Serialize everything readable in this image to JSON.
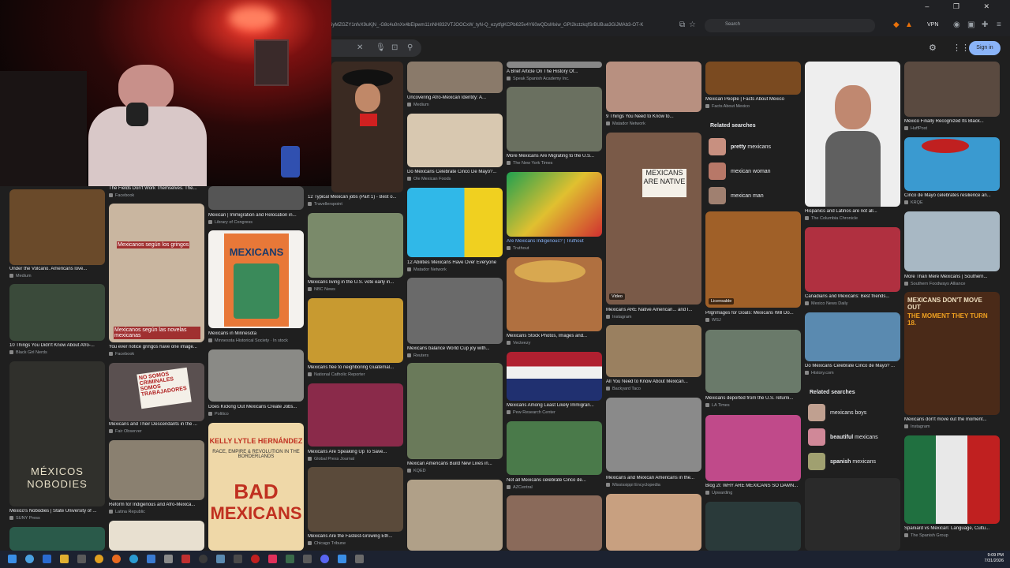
{
  "browser": {
    "url": "iyMZGZY1nfvX9uKjN_-G8c4u0nXx4bElpwm11nNH832VTJOOCxW_tyN-Q_ezytfgKCPb625v4Y60wQDsMxiw_GPI2kctzkqfSrBUBua3GiJMAb3-OT-K",
    "search_placeholder": "Search",
    "vpn_label": "VPN",
    "window_controls": "– ❐ ✕"
  },
  "google": {
    "sign_in": "Sign in"
  },
  "columns": [
    {
      "items": [
        {
          "caption": "The Fields Don't Work Themselves. The...",
          "source": "Facebook"
        },
        {
          "caption": "Under the Volcano. Americans love...",
          "source": "Medium"
        },
        {
          "caption": "10 Things You Didn't Know About Afro-...",
          "source": "Black Girl Nerds"
        },
        {
          "caption": "México's Nobodies | State University of ...",
          "source": "SUNY Press"
        }
      ]
    },
    {
      "items": [
        {
          "caption": "You ever notice gringos have one image...",
          "source": "Facebook"
        },
        {
          "caption": "Mexicans and Their Descendants in the ...",
          "source": "Fair Observer"
        },
        {
          "caption": "Reform for Indigenous and Afro-Mexica...",
          "source": "Latina Republic"
        }
      ]
    },
    {
      "items": [
        {
          "caption": "Mexican | Immigration and Relocation in...",
          "source": "Library of Congress"
        },
        {
          "caption": "Mexicans in Minnesota",
          "source": "Minnesota Historical Society · In stock"
        },
        {
          "caption": "Does Kicking Out Mexicans Create Jobs...",
          "source": "Politico"
        }
      ]
    },
    {
      "items": [
        {
          "caption": "12 Typical Mexican jobs (Part 1) - Best o...",
          "source": "Travellerspoint"
        },
        {
          "caption": "Mexicans living in the U.S. vote early in...",
          "source": "NBC News"
        },
        {
          "caption": "Mexicans flee to neighboring Guatemal...",
          "source": "National Catholic Reporter"
        },
        {
          "caption": "Mexicans Are Speaking Up To Save...",
          "source": "Global Press Journal"
        },
        {
          "caption": "Mexicans Are the Fastest-Growing Eth...",
          "source": "Chicago Tribune"
        }
      ]
    },
    {
      "items": [
        {
          "caption": "Uncovering Afro-Mexican Identity: A...",
          "source": "Medium"
        },
        {
          "caption": "Do Mexicans Celebrate Cinco De Mayo?...",
          "source": "Ole Mexican Foods"
        },
        {
          "caption": "12 Abilities Mexicans Have Over Everyone",
          "source": "Matador Network"
        },
        {
          "caption": "Mexicans balance World Cup joy with...",
          "source": "Reuters"
        },
        {
          "caption": "Mexican Americans Build New Lives in...",
          "source": "KQED"
        }
      ]
    },
    {
      "items": [
        {
          "caption": "A Brief Article On The History Of...",
          "source": "Speak Spanish Academy Inc."
        },
        {
          "caption": "More Mexicans Are Migrating to the U.S...",
          "source": "The New York Times"
        },
        {
          "caption": "Are Mexicans Indigenous? | Truthout",
          "source": "Truthout"
        },
        {
          "caption": "Mexicans Stock Photos, Images and...",
          "source": "Vecteezy"
        },
        {
          "caption": "Mexicans Among Least Likely Immigran...",
          "source": "Pew Research Center"
        },
        {
          "caption": "Not all Mexicans celebrate Cinco de...",
          "source": "AZCentral"
        }
      ]
    },
    {
      "items": [
        {
          "caption": "9 Things You Need to Know to...",
          "source": "Matador Network"
        },
        {
          "caption": "MEXICANS ARE NATIVE",
          "source": ""
        },
        {
          "caption": "Mexicans ARE Native American... and I...",
          "source": "Instagram"
        },
        {
          "caption": "All You Need to Know About Mexican...",
          "source": "Backyard Taco"
        },
        {
          "caption": "Mexicans and Mexican Americans in the...",
          "source": "Mississippi Encyclopedia"
        }
      ]
    },
    {
      "items": [
        {
          "caption": "Mexican People | Facts About Mexico",
          "source": "Facts About Mexico"
        },
        {
          "caption": "Pilgrimages for Goals: Mexicans Will Do...",
          "source": "WSJ"
        },
        {
          "caption": "Mexicans deported from the U.S. returni...",
          "source": "LA Times"
        },
        {
          "caption": "Blog 2I: WHY ARE MEXICANS SO DAMN...",
          "source": "Upwarding"
        }
      ]
    },
    {
      "items": [
        {
          "caption": "Hispanics and Latinos are not all...",
          "source": "The Columbia Chronicle"
        },
        {
          "caption": "Canadians and Mexicans: Best friends...",
          "source": "Mexico News Daily"
        },
        {
          "caption": "Do Mexicans Celebrate Cinco de Mayo? ...",
          "source": "History.com"
        }
      ]
    },
    {
      "items": [
        {
          "caption": "Mexico Finally Recognized Its Black...",
          "source": "HuffPost"
        },
        {
          "caption": "Cinco de Mayo celebrates resilience an...",
          "source": "KRQE"
        },
        {
          "caption": "More Than Mere Mexicans | Southern...",
          "source": "Southern Foodways Alliance"
        },
        {
          "caption": "Mexicans don't move out the moment...",
          "source": "Instagram"
        },
        {
          "caption": "Spaniard vs Mexican: Language, Cultu...",
          "source": "The Spanish Group"
        }
      ]
    }
  ],
  "related1": {
    "title": "Related searches",
    "items": [
      {
        "bold": "pretty",
        "rest": " mexicans"
      },
      {
        "bold": "",
        "rest": "mexican woman"
      },
      {
        "bold": "",
        "rest": "mexican man"
      }
    ]
  },
  "related2": {
    "title": "Related searches",
    "items": [
      {
        "bold": "",
        "rest": "mexicans boys"
      },
      {
        "bold": "beautiful",
        "rest": " mexicans"
      },
      {
        "bold": "spanish",
        "rest": " mexicans"
      }
    ]
  },
  "overlay_texts": {
    "mexicans_book": "MEXICANS",
    "nobodies_1": "MÉXICOS",
    "nobodies_2": "NOBODIES",
    "author": "KELLY LYTLE HERNÁNDEZ",
    "bad_subtitle": "RACE, EMPIRE & REVOLUTION IN THE BORDERLANDS",
    "bad_1": "BAD",
    "bad_2": "MEXICANS",
    "protest": "NO SOMOS CRIMINALES SOMOS TRABAJADORES",
    "insta_1": "MEXICANS DON'T MOVE OUT",
    "insta_2": "THE MOMENT THEY TURN 18.",
    "gringos_1": "Mexicanos según los gringos",
    "gringos_2": "Mexicanos según las novelas mexicanas",
    "video_badge": "Video",
    "licensable": "Licensable"
  },
  "taskbar": {
    "time": "9:09 PM",
    "date": "7/31/2026"
  }
}
